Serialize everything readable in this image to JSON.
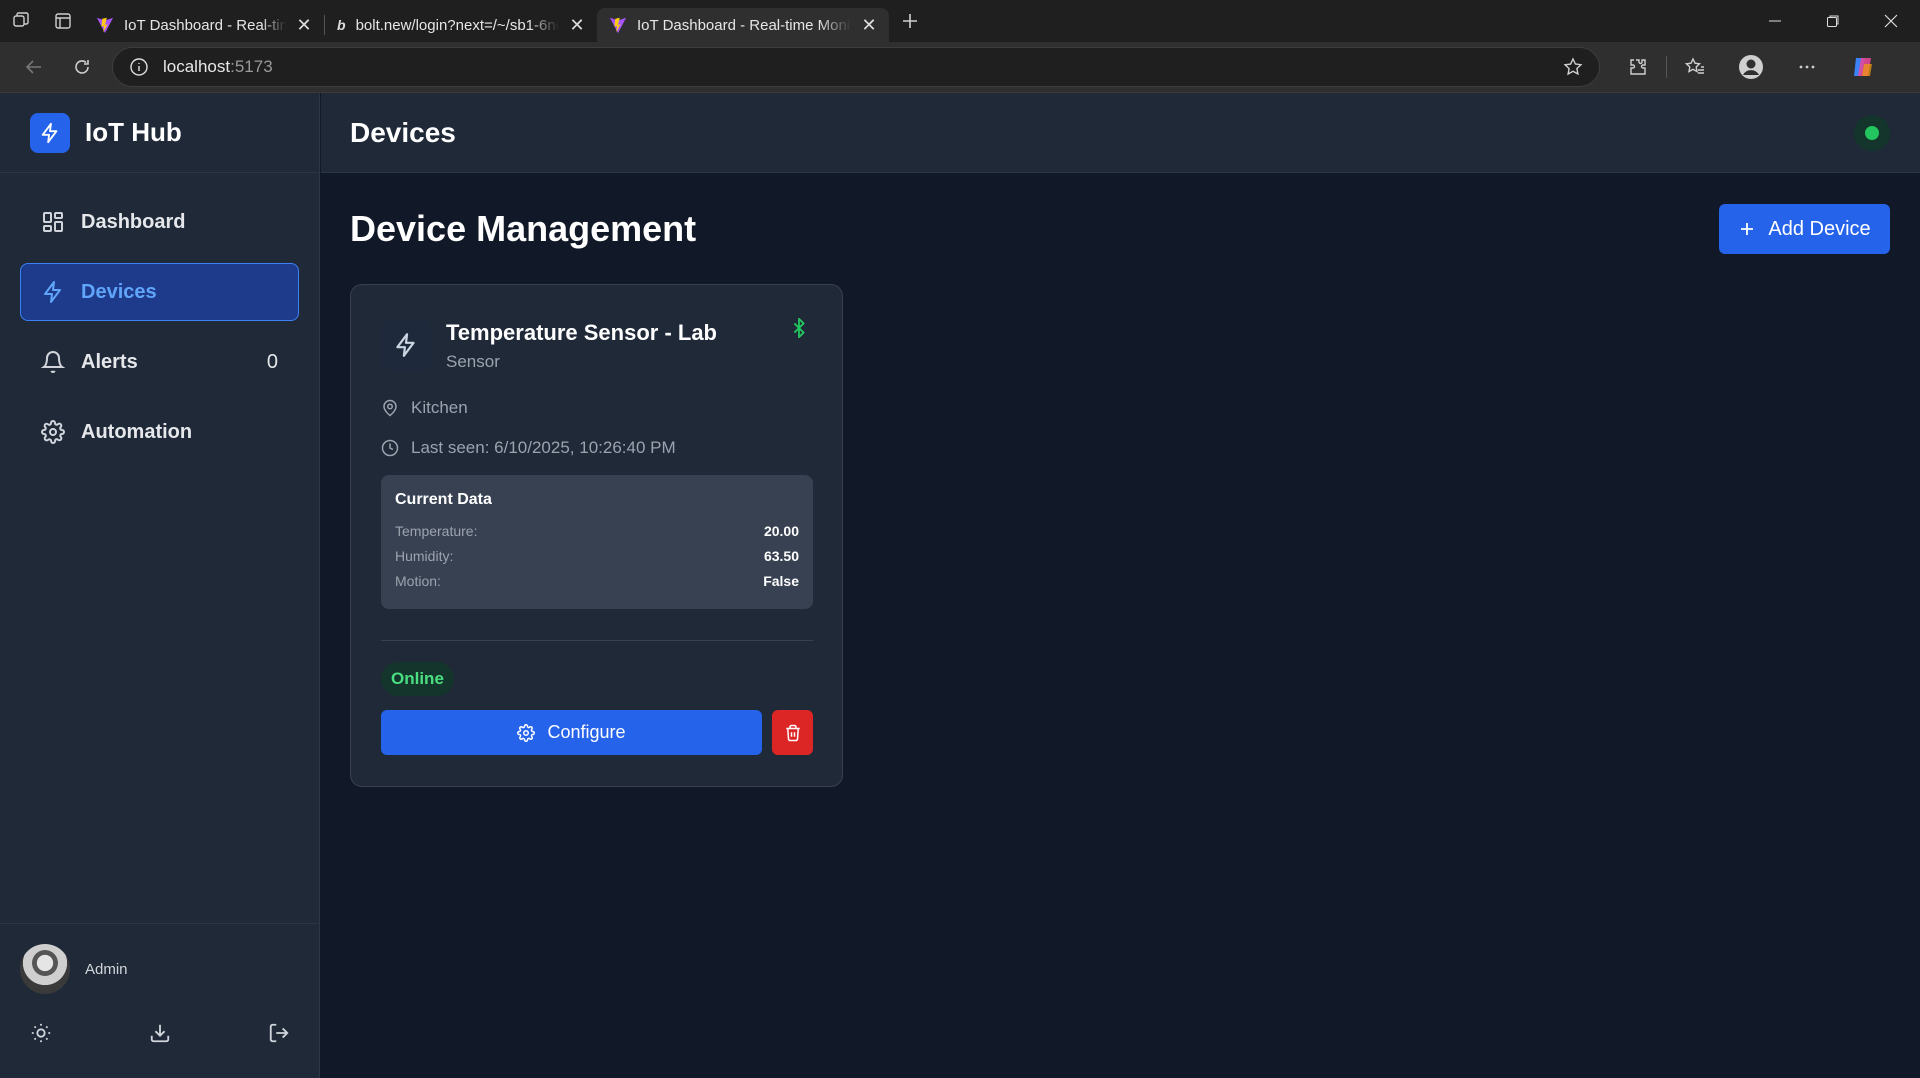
{
  "browser": {
    "tabs": [
      {
        "title": "IoT Dashboard - Real-time Monitoring",
        "active": false
      },
      {
        "title": "bolt.new/login?next=/~/sb1-6nqv",
        "active": false
      },
      {
        "title": "IoT Dashboard - Real-time Monitoring",
        "active": true
      }
    ],
    "url_host": "localhost",
    "url_port": ":5173"
  },
  "sidebar": {
    "brand": "IoT Hub",
    "items": [
      {
        "label": "Dashboard",
        "icon": "grid-icon"
      },
      {
        "label": "Devices",
        "icon": "zap-icon",
        "active": true
      },
      {
        "label": "Alerts",
        "icon": "bell-icon",
        "count": "0"
      },
      {
        "label": "Automation",
        "icon": "gear-icon"
      }
    ],
    "user": {
      "name": "Admin"
    }
  },
  "topbar": {
    "title": "Devices",
    "status_color": "#22c55e"
  },
  "main": {
    "title": "Device Management",
    "add_button": "Add Device",
    "devices": [
      {
        "name": "Temperature Sensor - Lab",
        "type": "Sensor",
        "location": "Kitchen",
        "last_seen": "Last seen: 6/10/2025, 10:26:40 PM",
        "data_title": "Current Data",
        "data": [
          {
            "label": "Temperature:",
            "value": "20.00"
          },
          {
            "label": "Humidity:",
            "value": "63.50"
          },
          {
            "label": "Motion:",
            "value": "False"
          }
        ],
        "status": "Online",
        "configure_label": "Configure"
      }
    ]
  },
  "colors": {
    "accent": "#2563eb",
    "online": "#22c55e",
    "danger": "#dc2626"
  }
}
